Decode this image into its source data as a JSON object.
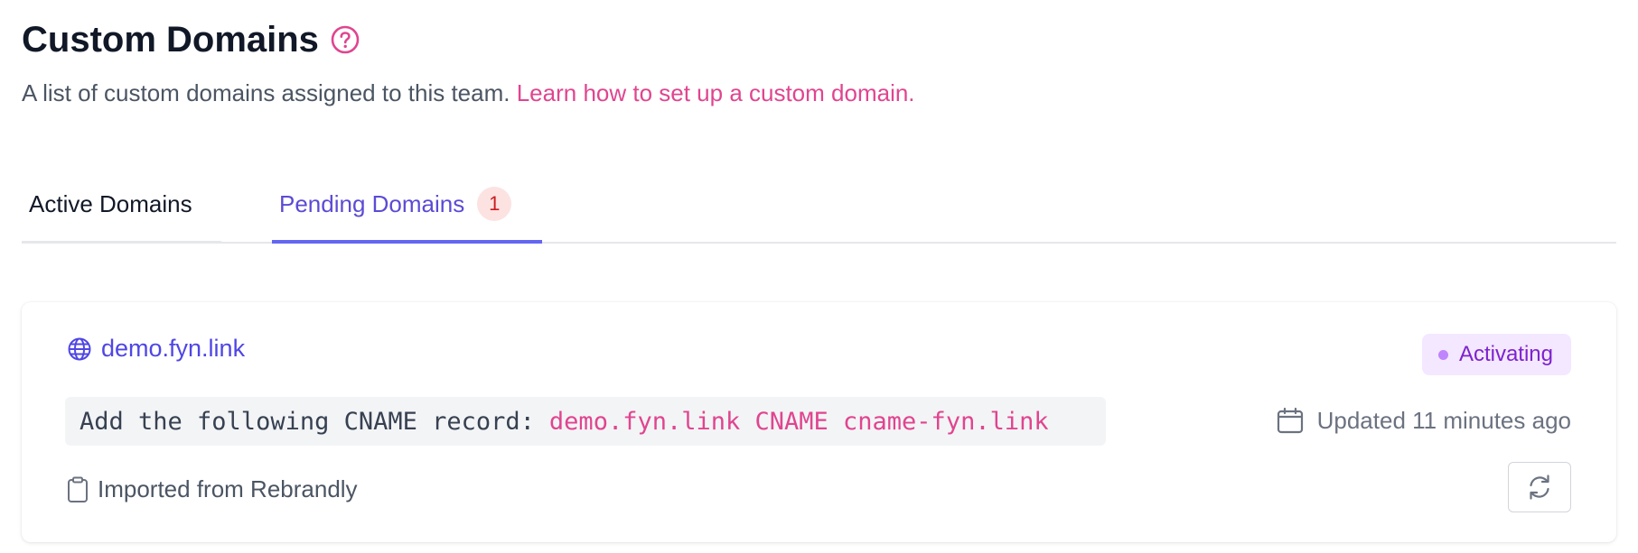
{
  "header": {
    "title": "Custom Domains",
    "description": "A list of custom domains assigned to this team.",
    "learn_link": "Learn how to set up a custom domain."
  },
  "tabs": [
    {
      "label": "Active Domains",
      "active": false
    },
    {
      "label": "Pending Domains",
      "active": true,
      "count": "1"
    }
  ],
  "domain_card": {
    "domain": "demo.fyn.link",
    "status": "Activating",
    "instruction": "Add the following CNAME record:",
    "cname_record": "demo.fyn.link CNAME cname-fyn.link",
    "updated": "Updated 11 minutes ago",
    "source": "Imported from Rebrandly"
  },
  "icons": {
    "help": "question-circle-icon",
    "domain": "globe-icon",
    "updated": "calendar-icon",
    "source": "clipboard-icon",
    "refresh": "refresh-icon"
  },
  "colors": {
    "accent_pink": "#e0458f",
    "accent_indigo": "#4f46e5",
    "status_bg": "#f3e8ff",
    "status_text": "#7e22ce",
    "badge_bg": "#fde2e2",
    "badge_text": "#c81e1e"
  }
}
